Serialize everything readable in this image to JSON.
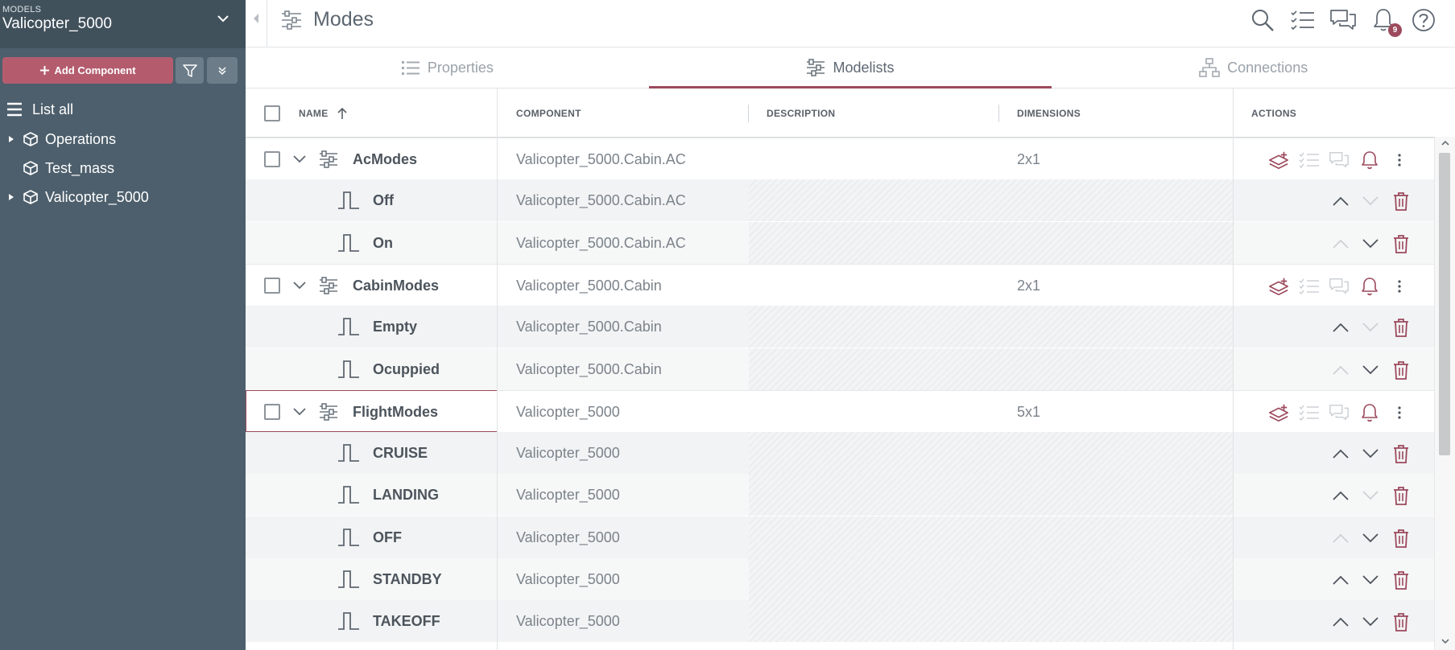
{
  "sidebar": {
    "models_caption": "MODELS",
    "model_name": "Valicopter_5000",
    "add_component_label": "Add Component",
    "list_all_label": "List all",
    "tree": [
      {
        "label": "Operations",
        "has_caret": true
      },
      {
        "label": "Test_mass",
        "has_caret": false
      },
      {
        "label": "Valicopter_5000",
        "has_caret": true
      }
    ]
  },
  "header": {
    "title": "Modes",
    "notification_count": "9",
    "icons": [
      "search-icon",
      "checklist-icon",
      "chat-icon",
      "bell-icon",
      "help-icon"
    ]
  },
  "tabs": [
    {
      "label": "Properties",
      "icon": "list-icon",
      "active": false
    },
    {
      "label": "Modelists",
      "icon": "sliders-icon",
      "active": true
    },
    {
      "label": "Connections",
      "icon": "hierarchy-icon",
      "active": false
    }
  ],
  "table": {
    "columns": {
      "name": "NAME",
      "component": "COMPONENT",
      "description": "DESCRIPTION",
      "dimensions": "DIMENSIONS",
      "actions": "ACTIONS"
    },
    "sort": "ascending",
    "rows": [
      {
        "type": "parent",
        "name": "AcModes",
        "component": "Valicopter_5000.Cabin.AC",
        "dimensions": "2x1"
      },
      {
        "type": "child",
        "name": "Off",
        "component": "Valicopter_5000.Cabin.AC",
        "up_enabled": true,
        "down_enabled": false
      },
      {
        "type": "child",
        "name": "On",
        "component": "Valicopter_5000.Cabin.AC",
        "up_enabled": false,
        "down_enabled": true
      },
      {
        "type": "parent",
        "name": "CabinModes",
        "component": "Valicopter_5000.Cabin",
        "dimensions": "2x1"
      },
      {
        "type": "child",
        "name": "Empty",
        "component": "Valicopter_5000.Cabin",
        "up_enabled": true,
        "down_enabled": false
      },
      {
        "type": "child",
        "name": "Ocuppied",
        "component": "Valicopter_5000.Cabin",
        "up_enabled": false,
        "down_enabled": true
      },
      {
        "type": "parent",
        "name": "FlightModes",
        "component": "Valicopter_5000",
        "dimensions": "5x1",
        "selected": true
      },
      {
        "type": "child",
        "name": "CRUISE",
        "component": "Valicopter_5000",
        "up_enabled": true,
        "down_enabled": true
      },
      {
        "type": "child",
        "name": "LANDING",
        "component": "Valicopter_5000",
        "up_enabled": true,
        "down_enabled": false
      },
      {
        "type": "child",
        "name": "OFF",
        "component": "Valicopter_5000",
        "up_enabled": false,
        "down_enabled": true
      },
      {
        "type": "child",
        "name": "STANDBY",
        "component": "Valicopter_5000",
        "up_enabled": true,
        "down_enabled": true
      },
      {
        "type": "child",
        "name": "TAKEOFF",
        "component": "Valicopter_5000",
        "up_enabled": true,
        "down_enabled": true
      }
    ]
  },
  "colors": {
    "accent": "#9c4a5c",
    "add_button": "#b45c6e",
    "sidebar": "#4d5f6c",
    "model_select": "#41515c"
  }
}
